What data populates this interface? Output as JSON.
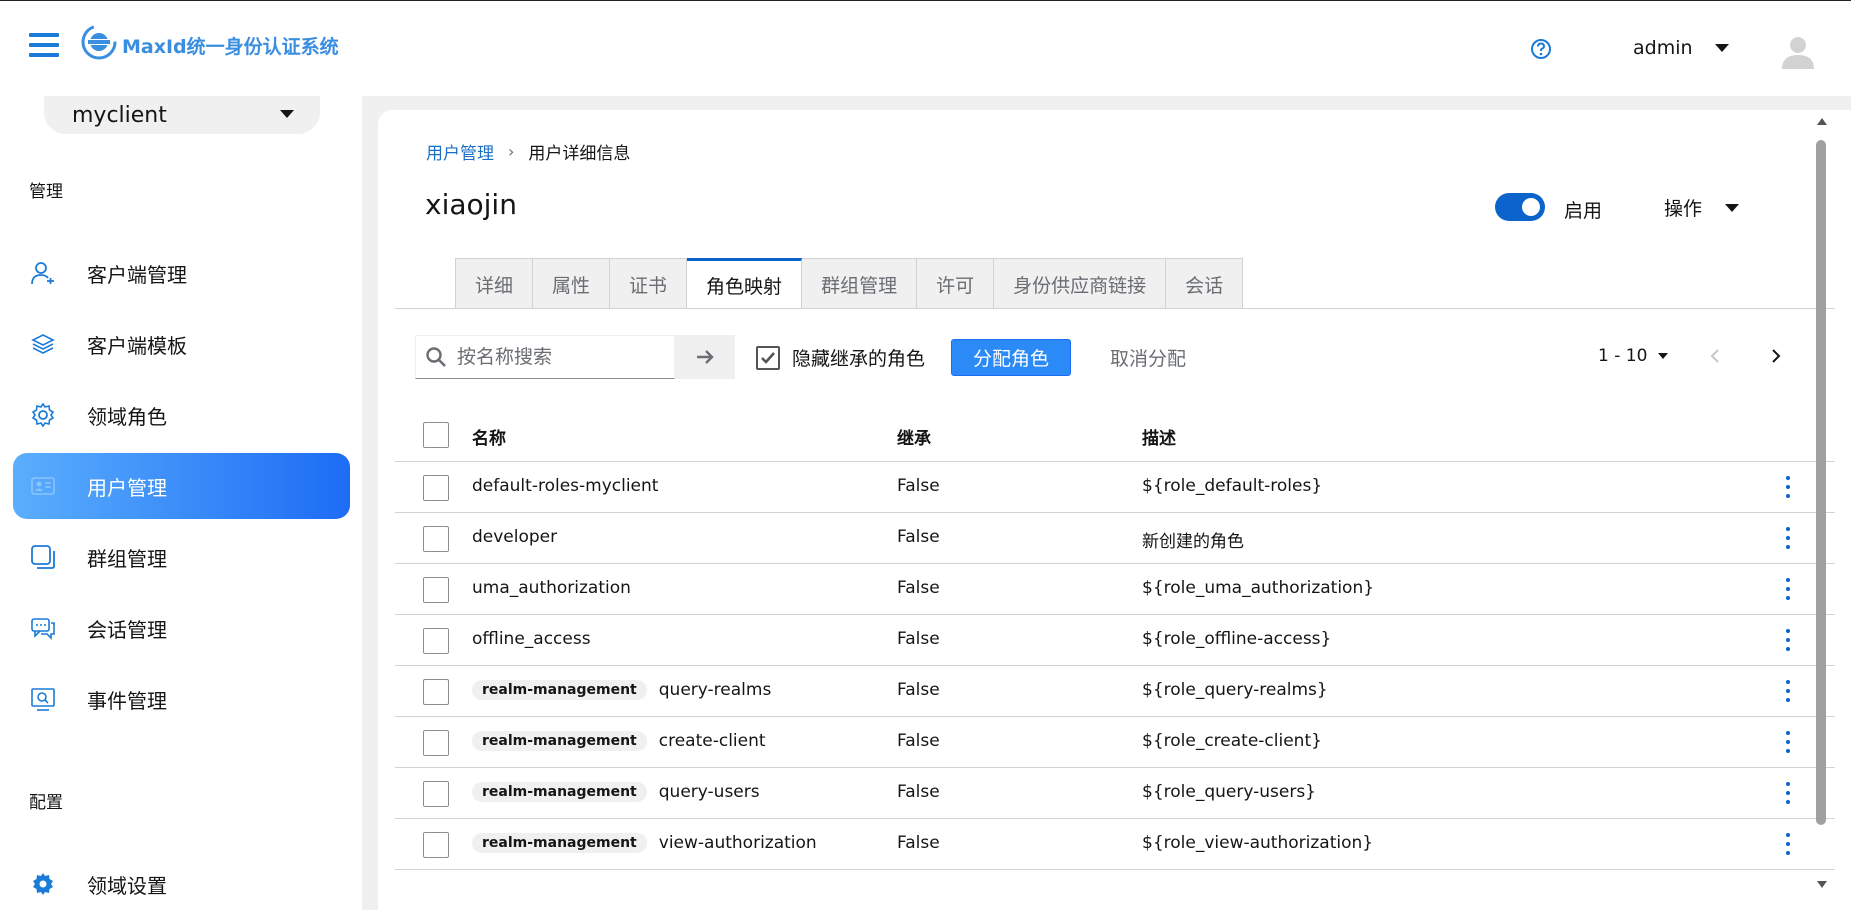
{
  "header": {
    "brand": "MaxId统一身份认证系统",
    "user_name": "admin"
  },
  "sidebar": {
    "client_selector": "myclient",
    "section_manage": "管理",
    "items": [
      {
        "label": "客户端管理",
        "icon": "user-icon"
      },
      {
        "label": "客户端模板",
        "icon": "layers-icon"
      },
      {
        "label": "领域角色",
        "icon": "gear-icon"
      },
      {
        "label": "用户管理",
        "icon": "id-card-icon",
        "active": true
      },
      {
        "label": "群组管理",
        "icon": "group-icon"
      },
      {
        "label": "会话管理",
        "icon": "chat-icon"
      },
      {
        "label": "事件管理",
        "icon": "event-icon"
      }
    ],
    "section_config": "配置",
    "config_items": [
      {
        "label": "领域设置",
        "icon": "gear-icon"
      }
    ]
  },
  "main": {
    "breadcrumb": {
      "parent": "用户管理",
      "current": "用户详细信息"
    },
    "title": "xiaojin",
    "enabled_label": "启用",
    "enabled": true,
    "actions_label": "操作",
    "tabs": [
      {
        "label": "详细"
      },
      {
        "label": "属性"
      },
      {
        "label": "证书"
      },
      {
        "label": "角色映射",
        "active": true
      },
      {
        "label": "群组管理"
      },
      {
        "label": "许可"
      },
      {
        "label": "身份供应商链接"
      },
      {
        "label": "会话"
      }
    ],
    "toolbar": {
      "search_placeholder": "按名称搜索",
      "hide_inherited_label": "隐藏继承的角色",
      "hide_inherited_checked": true,
      "assign_label": "分配角色",
      "unassign_label": "取消分配",
      "pagination": "1 - 10"
    },
    "table": {
      "columns": {
        "name": "名称",
        "inherited": "继承",
        "description": "描述"
      },
      "rows": [
        {
          "client": "",
          "name": "default-roles-myclient",
          "inherited": "False",
          "description": "${role_default-roles}"
        },
        {
          "client": "",
          "name": "developer",
          "inherited": "False",
          "description": "新创建的角色"
        },
        {
          "client": "",
          "name": "uma_authorization",
          "inherited": "False",
          "description": "${role_uma_authorization}"
        },
        {
          "client": "",
          "name": "offline_access",
          "inherited": "False",
          "description": "${role_offline-access}"
        },
        {
          "client": "realm-management",
          "name": "query-realms",
          "inherited": "False",
          "description": "${role_query-realms}"
        },
        {
          "client": "realm-management",
          "name": "create-client",
          "inherited": "False",
          "description": "${role_create-client}"
        },
        {
          "client": "realm-management",
          "name": "query-users",
          "inherited": "False",
          "description": "${role_query-users}"
        },
        {
          "client": "realm-management",
          "name": "view-authorization",
          "inherited": "False",
          "description": "${role_view-authorization}"
        }
      ]
    }
  }
}
